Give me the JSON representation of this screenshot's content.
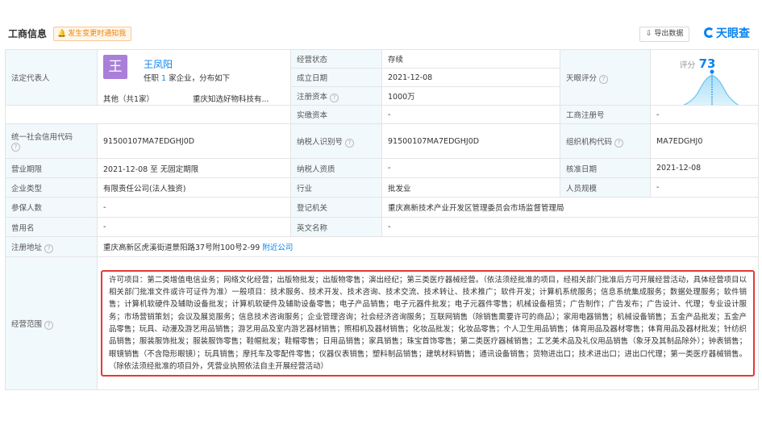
{
  "header": {
    "title": "工商信息",
    "notify_label": "发生变更时通知我",
    "export_label": "导出数据",
    "brand": "天眼查"
  },
  "representative": {
    "label": "法定代表人",
    "avatar_char": "王",
    "name": "王凤阳",
    "sub_prefix": "任职",
    "sub_count": "1",
    "sub_suffix": "家企业，分布如下",
    "other": "其他（共1家）",
    "company": "重庆知选好物科技有..."
  },
  "rows": {
    "status": {
      "label": "经营状态",
      "value": "存续"
    },
    "established": {
      "label": "成立日期",
      "value": "2021-12-08"
    },
    "capital": {
      "label": "注册资本",
      "value": "1000万"
    },
    "paid_capital": {
      "label": "实缴资本",
      "value": "-"
    },
    "score": {
      "label": "天眼评分",
      "score_label": "评分",
      "score_value": "73"
    },
    "reg_no": {
      "label": "工商注册号",
      "value": "-"
    },
    "credit_code": {
      "label": "统一社会信用代码",
      "value": "91500107MA7EDGHJ0D"
    },
    "taxpayer_id": {
      "label": "纳税人识别号",
      "value": "91500107MA7EDGHJ0D"
    },
    "org_code": {
      "label": "组织机构代码",
      "value": "MA7EDGHJ0"
    },
    "term": {
      "label": "营业期限",
      "value": "2021-12-08 至 无固定期限"
    },
    "taxpayer_qual": {
      "label": "纳税人资质",
      "value": "-"
    },
    "approval_date": {
      "label": "核准日期",
      "value": "2021-12-08"
    },
    "company_type": {
      "label": "企业类型",
      "value": "有限责任公司(法人独资)"
    },
    "industry": {
      "label": "行业",
      "value": "批发业"
    },
    "staff_size": {
      "label": "人员规模",
      "value": "-"
    },
    "insured": {
      "label": "参保人数",
      "value": "-"
    },
    "reg_authority": {
      "label": "登记机关",
      "value": "重庆高新技术产业开发区管理委员会市场监督管理局"
    },
    "former_name": {
      "label": "曾用名",
      "value": "-"
    },
    "english_name": {
      "label": "英文名称",
      "value": "-"
    },
    "address": {
      "label": "注册地址",
      "value": "重庆高新区虎溪街道景阳路37号附100号2-99",
      "link": "附近公司"
    },
    "scope": {
      "label": "经营范围",
      "value": "许可项目：第二类增值电信业务；网络文化经营；出版物批发；出版物零售；演出经纪；第三类医疗器械经营。（依法须经批准的项目，经相关部门批准后方可开展经营活动，具体经营项目以相关部门批准文件或许可证件为准）一般项目：技术服务、技术开发、技术咨询、技术交流、技术转让、技术推广；软件开发；计算机系统服务；信息系统集成服务；数据处理服务；软件销售；计算机软硬件及辅助设备批发；计算机软硬件及辅助设备零售；电子产品销售；电子元器件批发；电子元器件零售；机械设备租赁；广告制作；广告发布；广告设计、代理；专业设计服务；市场营销策划；会议及展览服务；信息技术咨询服务；企业管理咨询；社会经济咨询服务；互联网销售（除销售需要许可的商品）；家用电器销售；机械设备销售；五金产品批发；五金产品零售；玩具、动漫及游艺用品销售；游艺用品及室内游艺器材销售；照相机及器材销售；化妆品批发；化妆品零售；个人卫生用品销售；体育用品及器材零售；体育用品及器材批发；针纺织品销售；服装服饰批发；服装服饰零售；鞋帽批发；鞋帽零售；日用品销售；家具销售；珠宝首饰零售；第二类医疗器械销售；工艺美术品及礼仪用品销售（象牙及其制品除外）；钟表销售；眼镜销售（不含隐形眼镜）；玩具销售；摩托车及零配件零售；仪器仪表销售；塑料制品销售；建筑材料销售；通讯设备销售；货物进出口；技术进出口；进出口代理；第一类医疗器械销售。（除依法须经批准的项目外，凭营业执照依法自主开展经营活动）"
    }
  },
  "score_chart": {
    "ticks": [
      "0",
      "5",
      "11",
      "15",
      "50",
      "65",
      "87",
      "88",
      "100"
    ],
    "score": 73,
    "accent": "#0b84ee",
    "curve_color": "#8fd3f2"
  },
  "colors": {
    "accent": "#0b84ee",
    "label_bg": "#f2f9fc",
    "scope_border": "#e53935",
    "notify": "#f08300"
  }
}
